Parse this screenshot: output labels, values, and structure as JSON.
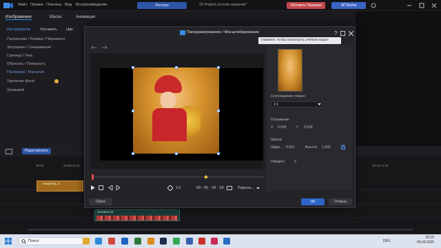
{
  "topbar": {
    "menu": [
      "Файл",
      "Правка",
      "Плагины",
      "Вид",
      "Воспроизведение"
    ],
    "export_label": "Экспорт",
    "project_title": "23 Project усстом заказчик*",
    "upgrade_label": "Обновить Премиум",
    "signin_label": "АП Войти"
  },
  "left_panel": {
    "tabs": [
      "Изображение",
      "Маска",
      "Анимация"
    ],
    "subtabs": [
      "Инструменты",
      "Улучшить",
      "Цве"
    ],
    "items": [
      "Положение / Размер / Переворот",
      "Затухание / Смешивание",
      "Граница / Тень",
      "Обрезать / Повернуть",
      "Панорама / Масштаб",
      "Удаление фона",
      "Хромакей"
    ]
  },
  "dialog": {
    "title": "Панорамирование / Масштабирование",
    "tooltip": "Нажмите, чтобы посмотреть учебное видео",
    "aspect_label": "Соотношение сторон:",
    "aspect_value": "1:1",
    "position_label": "Положение:",
    "pos_x_label": "X",
    "pos_x": "0,500",
    "pos_y_label": "Y",
    "pos_y": "0,500",
    "scale_label": "Шкала:",
    "width_label": "Шири...",
    "width_value": "0,561",
    "height_label": "Высота",
    "height_value": "1,000",
    "rotation_label": "Поворот:",
    "rotation_value": "0",
    "timecode": "00 : 00 : 00 : 00",
    "fit_label": "Подогна...",
    "speed_value": "1.0",
    "reset_label": "Сброс",
    "ok_label": "OK",
    "cancel_label": "Отмена"
  },
  "timeline": {
    "edit_label": "Редактировать",
    "ticks": [
      "00:00",
      "00:00:02:00",
      "00:00:04:00",
      "00:00:06:00",
      "00:00:08:00",
      "00:00:10:00",
      "00:00:12:00",
      "00:00:14:00"
    ],
    "video_clip_label": "Snapfinal_cr",
    "audio_clip_label": "Suruana 02"
  },
  "taskbar": {
    "search_placeholder": "Поиск",
    "lang": "DEU",
    "time": "16:10",
    "date": "05.04.2025"
  },
  "colors": {
    "accent": "#2e64c9",
    "clip_video": "#a06a1c",
    "clip_audio": "#1c3c3a",
    "upgrade": "#c2474c"
  }
}
